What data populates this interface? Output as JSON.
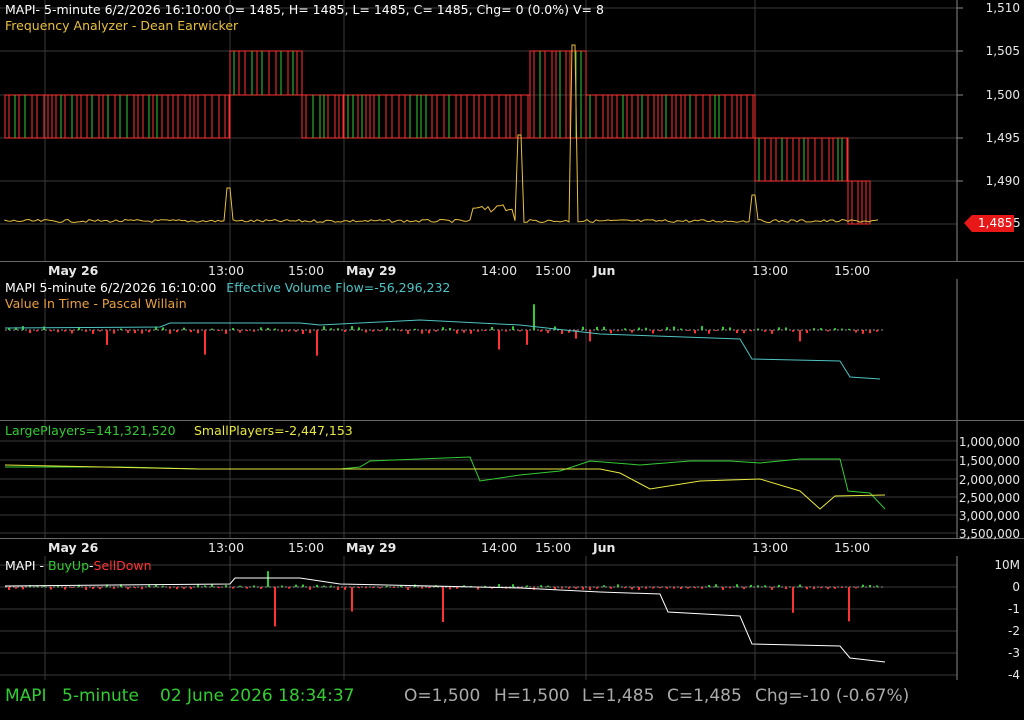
{
  "colors": {
    "green": "#33cc33",
    "red": "#ff3333",
    "yellow": "#e8c040",
    "cyan": "#4fc3c3",
    "white": "#ffffff",
    "grid": "#3a3a3a"
  },
  "panel1": {
    "title_line": "MAPI- 5-minute 6/2/2026 16:10:00 O= 1485, H= 1485, L= 1485, C= 1485, Chg= 0 (0.0%) V= 8",
    "indicator": "Frequency Analyzer - Dean Earwicker",
    "price_axis": [
      "1,510",
      "1,505",
      "1,500",
      "1,495",
      "1,490"
    ],
    "last_price": "1,485",
    "last_price_suffix": "5"
  },
  "time_axis": [
    "May 26",
    "13:00",
    "15:00",
    "May 29",
    "14:00",
    "15:00",
    "Jun",
    "13:00",
    "15:00"
  ],
  "panel2": {
    "title_prefix": "MAPI 5-minute  6/2/2026 16:10:00",
    "title_evf": "Effective Volume Flow=-56,296,232",
    "indicator": "Value In Time - Pascal Willain"
  },
  "panel3": {
    "large": "LargePlayers=141,321,520",
    "small": "SmallPlayers=-2,447,153",
    "axis": [
      "1,000,000",
      "1,500,000",
      "2,000,000",
      "2,500,000",
      "3,000,000",
      "3,500,000"
    ]
  },
  "panel4": {
    "title_prefix": "MAPI - ",
    "buy": "BuyUp",
    "sep": "-",
    "sell": "SellDown",
    "axis": [
      "10M",
      "0",
      "-1",
      "-2",
      "-3",
      "-4"
    ]
  },
  "status": {
    "symbol": "MAPI",
    "interval": "5-minute",
    "datetime": "02 June 2026 18:34:37",
    "o": "O=1,500",
    "h": "H=1,500",
    "l": "L=1,485",
    "c": "C=1,485",
    "chg": "Chg=-10 (-0.67%)"
  }
}
